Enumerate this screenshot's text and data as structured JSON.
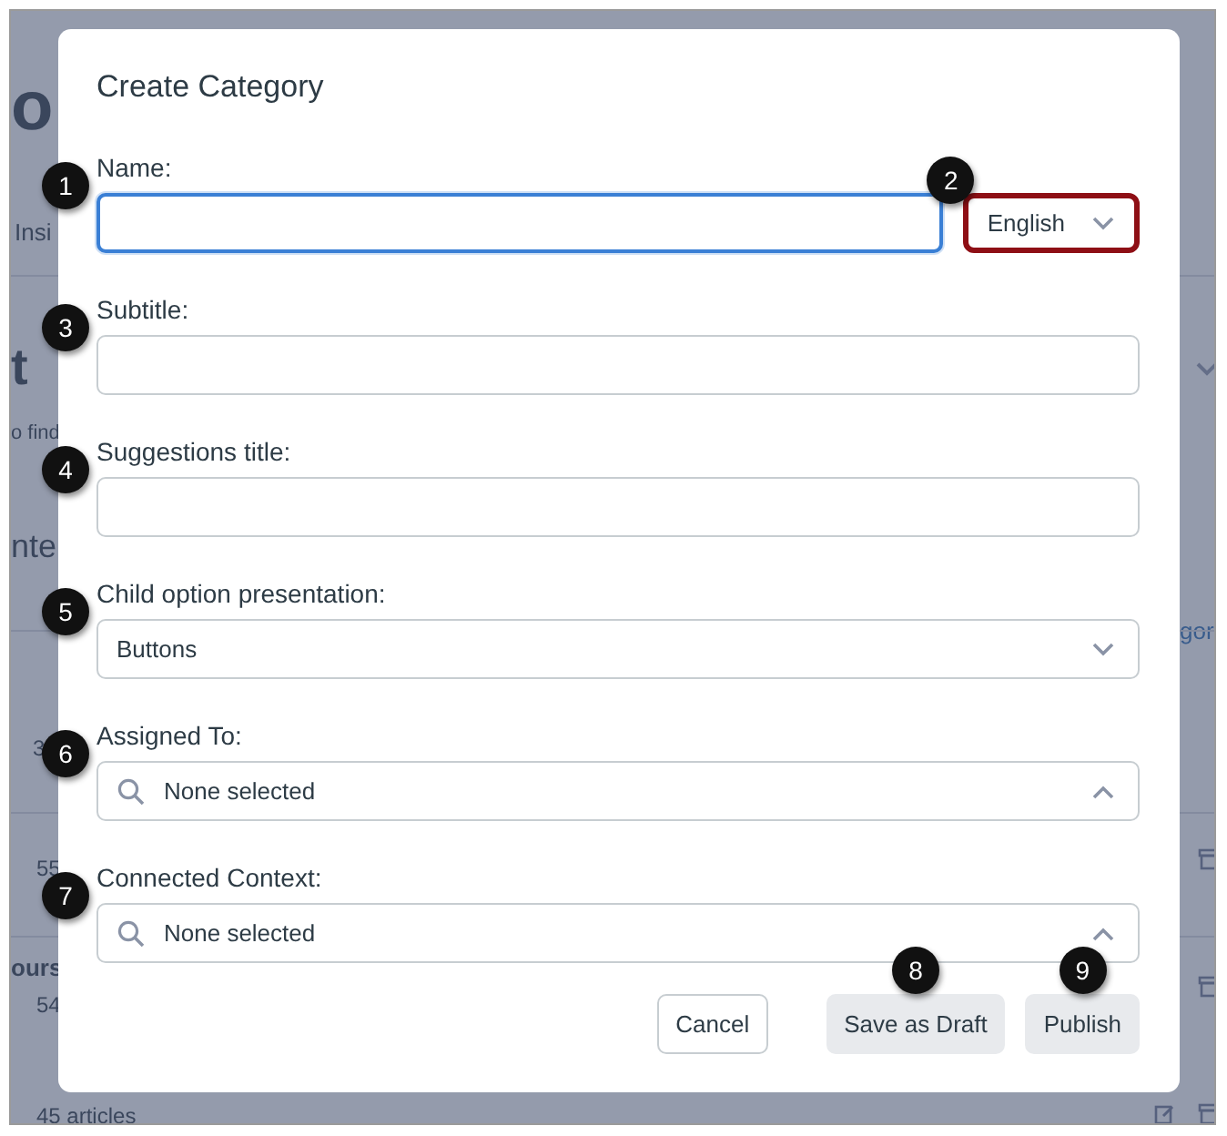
{
  "backdrop": {
    "fragments": [
      {
        "kind": "heading",
        "text": "o"
      },
      {
        "kind": "tab",
        "text": "Insi"
      },
      {
        "kind": "heading",
        "text": "t"
      },
      {
        "kind": "note",
        "text": "o find"
      },
      {
        "kind": "subheading",
        "text": "nte"
      },
      {
        "kind": "count",
        "text": "3"
      },
      {
        "kind": "count",
        "text": "55"
      },
      {
        "kind": "name",
        "text": "ours"
      },
      {
        "kind": "count",
        "text": "54"
      },
      {
        "kind": "count",
        "text": "45 articles"
      },
      {
        "kind": "link",
        "text": "gor"
      }
    ]
  },
  "dialog": {
    "title": "Create Category",
    "fields": [
      {
        "kind": "text",
        "label": "Name:",
        "callout": "1",
        "focused": true,
        "language": {
          "value": "English",
          "callout": "2",
          "highlighted": true
        }
      },
      {
        "kind": "text",
        "label": "Subtitle:",
        "callout": "3",
        "focused": false
      },
      {
        "kind": "text",
        "label": "Suggestions title:",
        "callout": "4",
        "focused": false
      },
      {
        "kind": "select",
        "label": "Child option presentation:",
        "callout": "5",
        "value": "Buttons"
      },
      {
        "kind": "search",
        "label": "Assigned To:",
        "callout": "6",
        "placeholder": "None selected",
        "expanded": true
      },
      {
        "kind": "search",
        "label": "Connected Context:",
        "callout": "7",
        "placeholder": "None selected",
        "expanded": true
      }
    ],
    "buttons": [
      {
        "label": "Cancel",
        "kind": "outline"
      },
      {
        "label": "Save as Draft",
        "kind": "filled",
        "callout": "8"
      },
      {
        "label": "Publish",
        "kind": "filled",
        "callout": "9"
      }
    ]
  }
}
